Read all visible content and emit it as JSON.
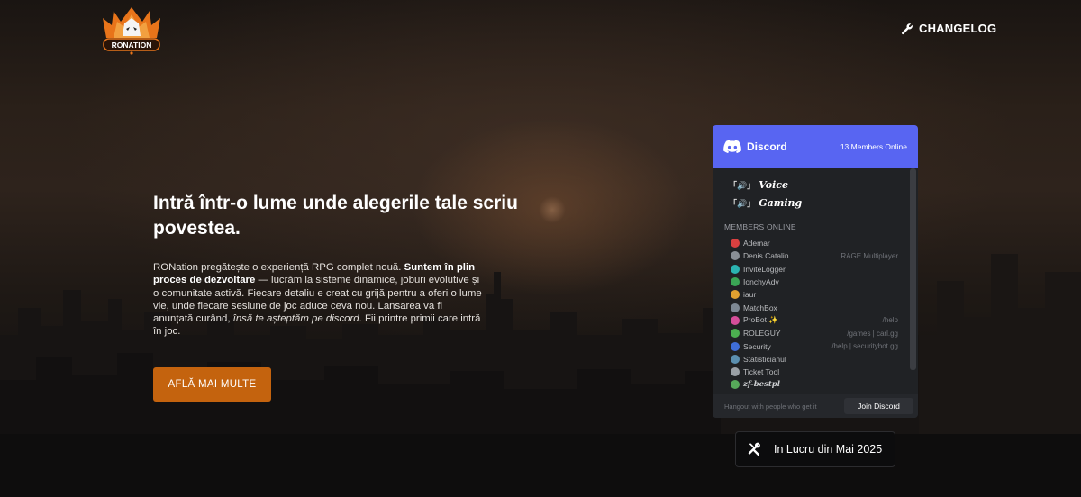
{
  "brand": {
    "logo_text": "RONATION"
  },
  "nav": {
    "changelog_label": "CHANGELOG",
    "changelog_icon": "wrench-icon"
  },
  "hero": {
    "title": "Intră într-o lume unde alegerile tale scriu povestea.",
    "desc_part1": "RONation pregătește o experiență RPG complet nouă. ",
    "desc_bold": "Suntem în plin proces de dezvoltare",
    "desc_part2": " — lucrăm la sisteme dinamice, joburi evolutive și o comunitate activă. Fiecare detaliu e creat cu grijă pentru a oferi o lume vie, unde fiecare sesiune de joc aduce ceva nou. Lansarea va fi anunțată curând, ",
    "desc_italic": "însă te așteptăm pe discord",
    "desc_part3": ". Fii printre primii care intră în joc.",
    "cta_label": "AFLĂ MAI MULTE",
    "accent_color": "#c4630e"
  },
  "discord": {
    "brand_label": "Discord",
    "online_count": "13 Members Online",
    "header_color": "#5865f2",
    "channels": [
      {
        "prefix": "「🔊」",
        "name": "Voice"
      },
      {
        "prefix": "「🔊」",
        "name": "Gaming"
      }
    ],
    "members_label": "MEMBERS ONLINE",
    "members": [
      {
        "name": "Ademar",
        "game": "",
        "color": "#d94040",
        "special": false
      },
      {
        "name": "Denis Catalin",
        "game": "RAGE Multiplayer",
        "color": "#8a8f96",
        "special": false
      },
      {
        "name": "InviteLogger",
        "game": "",
        "color": "#2bb3b1",
        "special": false
      },
      {
        "name": "IonchyAdv",
        "game": "",
        "color": "#3aa655",
        "special": false
      },
      {
        "name": "iaur",
        "game": "",
        "color": "#e0a030",
        "special": false
      },
      {
        "name": "MatchBox",
        "game": "",
        "color": "#7d8894",
        "special": false
      },
      {
        "name": "ProBot ✨",
        "game": "/help",
        "color": "#d44e9a",
        "special": false
      },
      {
        "name": "ROLEGUY",
        "game": "/games | carl.gg",
        "color": "#4caf50",
        "special": false
      },
      {
        "name": "Security",
        "game": "/help | securitybot.gg",
        "color": "#3f6ed8",
        "special": false
      },
      {
        "name": "Statisticianul",
        "game": "",
        "color": "#5b8fb0",
        "special": false
      },
      {
        "name": "Ticket Tool",
        "game": "",
        "color": "#9aa0a6",
        "special": false
      },
      {
        "name": "zf-bestpl",
        "game": "",
        "color": "#57a85a",
        "special": true
      }
    ],
    "footer_text": "Hangout with people who get it",
    "join_label": "Join Discord"
  },
  "status": {
    "label": "In Lucru din Mai 2025",
    "icon": "tools-icon"
  }
}
